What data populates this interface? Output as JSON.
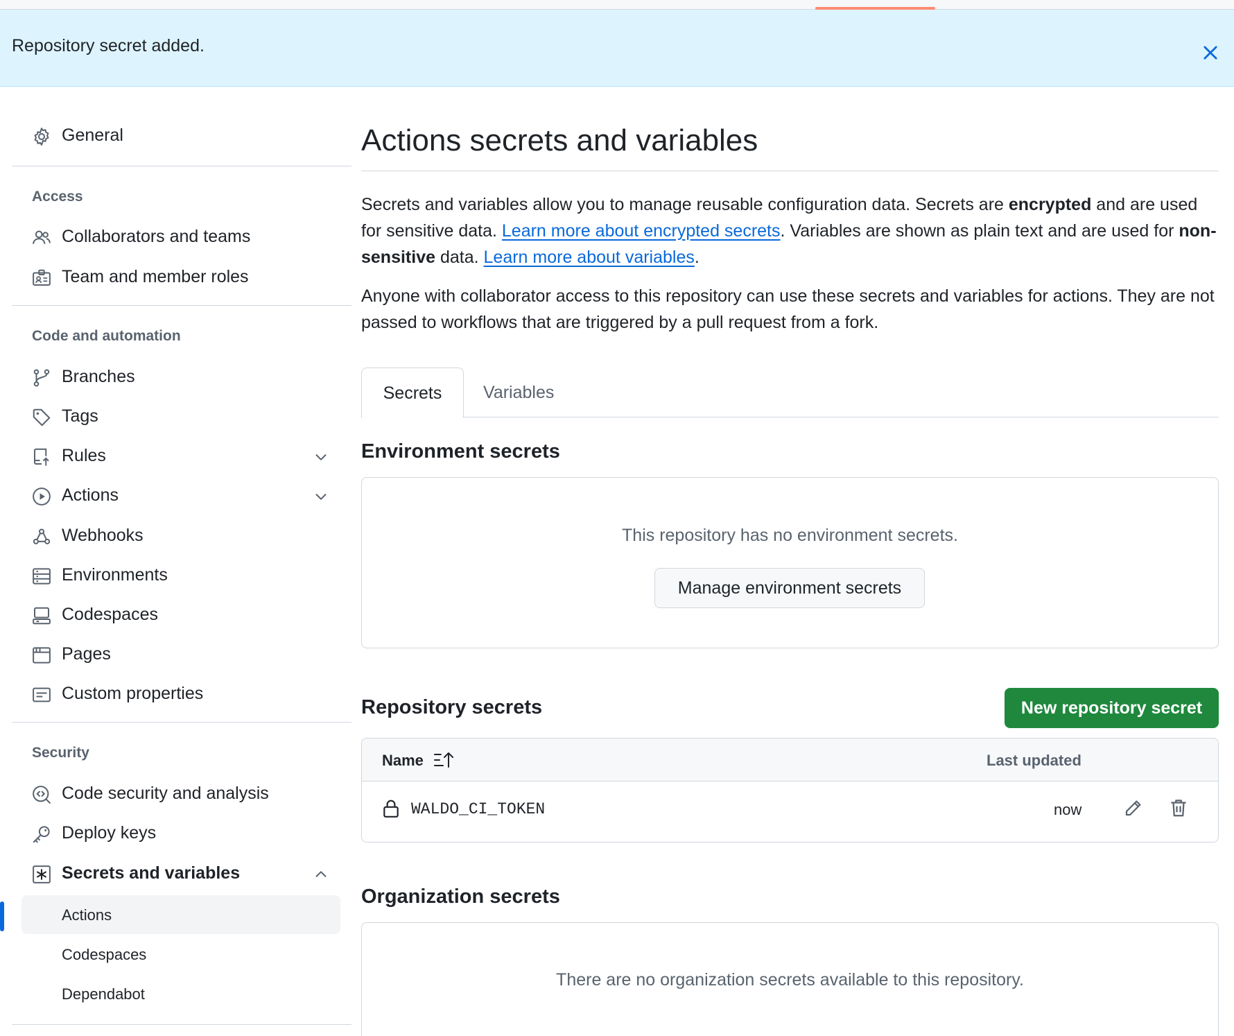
{
  "flash": {
    "message": "Repository secret added.",
    "close_icon": "x-icon"
  },
  "sidebar": {
    "general": {
      "label": "General",
      "icon": "gear-icon"
    },
    "access": {
      "title": "Access",
      "items": [
        {
          "label": "Collaborators and teams",
          "icon": "people-icon"
        },
        {
          "label": "Team and member roles",
          "icon": "id-badge-icon"
        }
      ]
    },
    "code_automation": {
      "title": "Code and automation",
      "items": [
        {
          "label": "Branches",
          "icon": "git-branch-icon"
        },
        {
          "label": "Tags",
          "icon": "tag-icon"
        },
        {
          "label": "Rules",
          "icon": "repo-push-icon",
          "expandable": true
        },
        {
          "label": "Actions",
          "icon": "play-icon",
          "expandable": true
        },
        {
          "label": "Webhooks",
          "icon": "webhook-icon"
        },
        {
          "label": "Environments",
          "icon": "server-icon"
        },
        {
          "label": "Codespaces",
          "icon": "codespaces-icon"
        },
        {
          "label": "Pages",
          "icon": "browser-icon"
        },
        {
          "label": "Custom properties",
          "icon": "note-icon"
        }
      ]
    },
    "security": {
      "title": "Security",
      "items": [
        {
          "label": "Code security and analysis",
          "icon": "codescan-icon"
        },
        {
          "label": "Deploy keys",
          "icon": "key-icon"
        },
        {
          "label": "Secrets and variables",
          "icon": "asterisk-box-icon",
          "expanded": true
        }
      ],
      "sub_items": [
        {
          "label": "Actions",
          "active": true
        },
        {
          "label": "Codespaces"
        },
        {
          "label": "Dependabot"
        }
      ]
    }
  },
  "main": {
    "title": "Actions secrets and variables",
    "intro": {
      "t1": "Secrets and variables allow you to manage reusable configuration data. Secrets are ",
      "b1": "encrypted",
      "t2": " and are used for sensitive data. ",
      "link1": "Learn more about encrypted secrets",
      "t3": ". Variables are shown as plain text and are used for ",
      "b2": "non-sensitive",
      "t4": " data. ",
      "link2": "Learn more about variables",
      "t5": "."
    },
    "notice": "Anyone with collaborator access to this repository can use these secrets and variables for actions. They are not passed to workflows that are triggered by a pull request from a fork.",
    "tabs": [
      {
        "label": "Secrets",
        "selected": true
      },
      {
        "label": "Variables"
      }
    ],
    "environment_secrets": {
      "title": "Environment secrets",
      "empty": "This repository has no environment secrets.",
      "button": "Manage environment secrets"
    },
    "repository_secrets": {
      "title": "Repository secrets",
      "new_button": "New repository secret",
      "columns": {
        "name": "Name",
        "updated": "Last updated"
      },
      "rows": [
        {
          "name": "WALDO_CI_TOKEN",
          "updated": "now"
        }
      ]
    },
    "organization_secrets": {
      "title": "Organization secrets",
      "empty": "There are no organization secrets available to this repository."
    }
  },
  "colors": {
    "accent": "#0969da",
    "primary": "#1f883d",
    "flash_bg": "#ddf4ff",
    "border": "#d0d7de"
  }
}
